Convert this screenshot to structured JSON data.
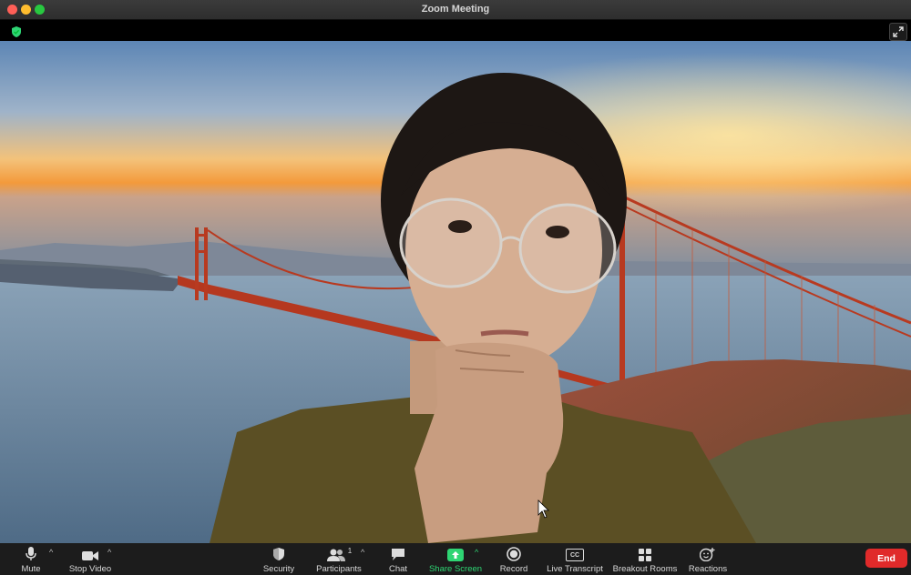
{
  "window": {
    "title": "Zoom Meeting"
  },
  "toolbar": {
    "mute": "Mute",
    "stop_video": "Stop Video",
    "security": "Security",
    "participants": "Participants",
    "participant_count": "1",
    "chat": "Chat",
    "share_screen": "Share Screen",
    "record": "Record",
    "live_transcript": "Live Transcript",
    "cc_badge": "CC",
    "breakout_rooms": "Breakout Rooms",
    "reactions": "Reactions",
    "end": "End"
  },
  "colors": {
    "end_red": "#e02a2a",
    "share_green": "#2ed573",
    "shield_green": "#2ed573"
  },
  "icons": [
    "shield-check-icon",
    "expand-icon",
    "microphone-icon",
    "video-camera-icon",
    "security-shield-icon",
    "participants-icon",
    "chat-bubble-icon",
    "share-arrow-icon",
    "record-icon",
    "cc-icon",
    "grid-icon",
    "emoji-icon"
  ]
}
